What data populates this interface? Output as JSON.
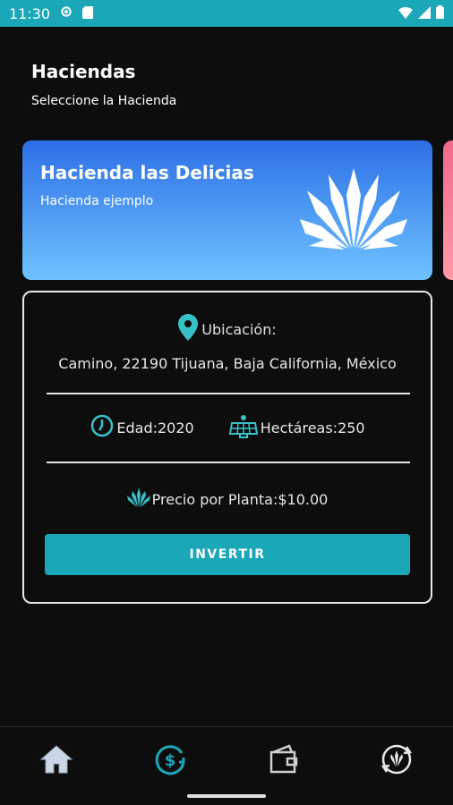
{
  "status_bar": {
    "time": "11:30",
    "bg_color": "#1aa7b8"
  },
  "header": {
    "title": "Haciendas",
    "subtitle": "Seleccione la Hacienda"
  },
  "hacienda_card": {
    "title": "Hacienda las Delicias",
    "subtitle": "Hacienda ejemplo",
    "icon": "agave-icon"
  },
  "details": {
    "location_label": "Ubicación:",
    "address": "Camino, 22190 Tijuana, Baja California, México",
    "age_label": "Edad:2020",
    "hectares_label": "Hectáreas:250",
    "price_label": "Precio por Planta:$10.00",
    "invest_button": "INVERTIR",
    "accent_color": "#1aa7b8"
  },
  "bottom_nav": {
    "items": [
      "home-icon",
      "invest-icon",
      "wallet-icon",
      "exchange-icon"
    ],
    "active": "invest-icon"
  }
}
